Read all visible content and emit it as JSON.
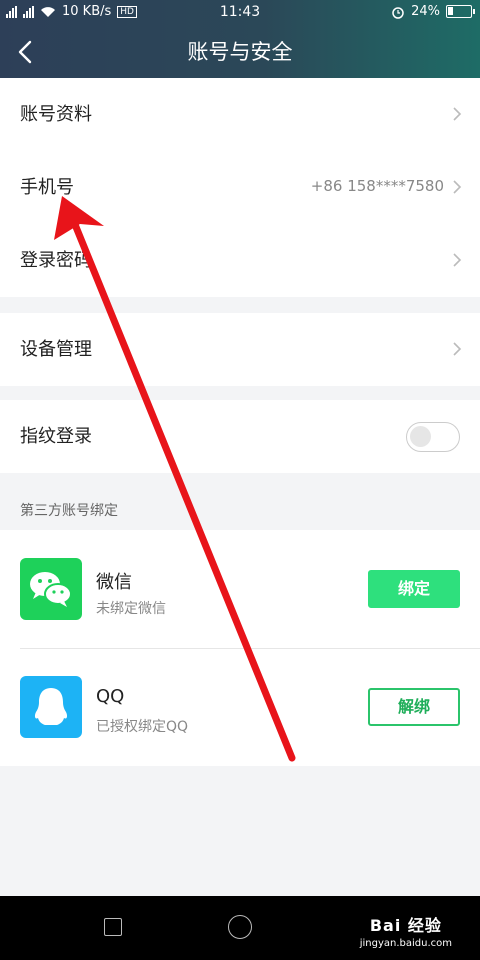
{
  "status_bar": {
    "network_speed": "10 KB/s",
    "hd_badge": "HD",
    "time": "11:43",
    "battery": "24%",
    "battery_level": 0.24
  },
  "header": {
    "title": "账号与安全"
  },
  "account_rows": [
    {
      "label": "账号资料",
      "value": ""
    },
    {
      "label": "手机号",
      "value": "+86 158****7580"
    },
    {
      "label": "登录密码",
      "value": ""
    }
  ],
  "device": {
    "label": "设备管理"
  },
  "fingerprint": {
    "label": "指纹登录",
    "enabled": false
  },
  "third_party": {
    "caption": "第三方账号绑定",
    "items": [
      {
        "name": "微信",
        "status": "未绑定微信",
        "action": "绑定",
        "icon": "wechat-icon"
      },
      {
        "name": "QQ",
        "status": "已授权绑定QQ",
        "action": "解绑",
        "icon": "qq-icon"
      }
    ]
  },
  "watermark": {
    "brand": "Bai 经验",
    "url": "jingyan.baidu.com"
  },
  "colors": {
    "accent_green": "#2ee07d",
    "wechat_green": "#1ed15a",
    "qq_blue": "#1db3f5",
    "arrow_red": "#e8141a"
  }
}
